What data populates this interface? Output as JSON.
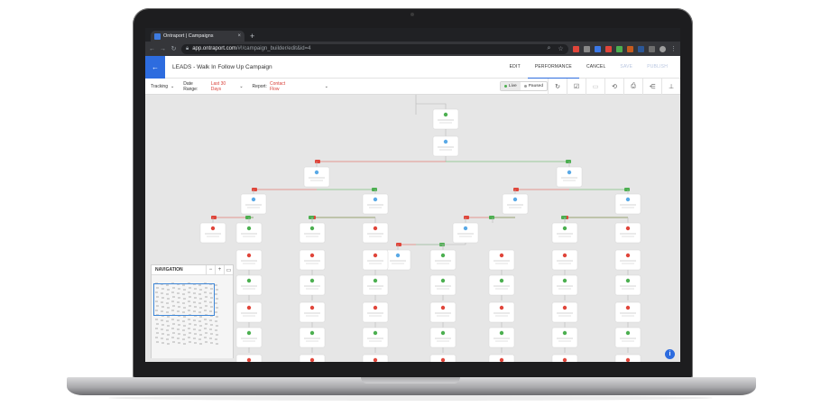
{
  "browser": {
    "tab_title": "Ontraport | Campaigns",
    "tab_close": "×",
    "new_tab": "+",
    "url_host": "app.ontraport.com",
    "url_path": "/#!/campaign_builder/edit&id=4"
  },
  "header": {
    "title": "LEADS - Walk In Follow Up Campaign",
    "actions": [
      "EDIT",
      "PERFORMANCE",
      "CANCEL",
      "SAVE",
      "PUBLISH"
    ],
    "active_action": "PERFORMANCE"
  },
  "toolbar": {
    "tracking_label": "Tracking",
    "date_range_label": "Date Range:",
    "date_range_value": "Last 30 Days",
    "report_label": "Report:",
    "report_value": "Contact Flow",
    "live_label": "Live",
    "paused_label": "Paused"
  },
  "navigation": {
    "title": "NAVIGATION",
    "zoom_out": "−",
    "zoom_in": "+"
  },
  "colors": {
    "accent": "#2d6cdf",
    "yes_branch": "#4caf50",
    "no_branch": "#e0453a",
    "step_icon": "#5aa9e6",
    "wait_icon": "#4caf50",
    "stop_icon": "#e0453a"
  },
  "icons": {
    "back": "arrow-left-icon",
    "refresh": "refresh-icon",
    "checklist": "checklist-icon",
    "comment": "comment-icon",
    "history": "history-icon",
    "print": "print-icon",
    "share": "share-icon",
    "pin": "pin-icon",
    "info": "info-icon",
    "help": "question-icon"
  }
}
